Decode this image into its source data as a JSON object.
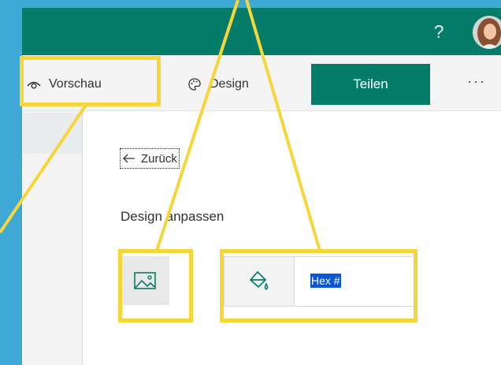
{
  "header": {
    "help_label": "?"
  },
  "toolbar": {
    "preview_label": "Vorschau",
    "design_label": "Design",
    "share_label": "Teilen",
    "more_label": "···"
  },
  "panel": {
    "back_label": "Zurück",
    "section_title": "Design anpassen",
    "hex_placeholder": "Hex #"
  },
  "colors": {
    "brand": "#047c69",
    "highlight": "#f7d63a",
    "background": "#3fa9d5",
    "selection": "#0a56d8"
  }
}
